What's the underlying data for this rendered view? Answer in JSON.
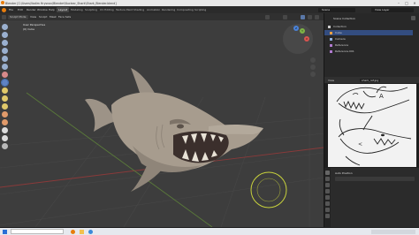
{
  "window": {
    "title": "Blender [C:\\Users\\Vadim Hrysnov\\Blender\\Nuclear_Shark\\Shark_Blender.blend]",
    "controls": [
      "–",
      "□",
      "✕"
    ]
  },
  "menu": {
    "items": [
      "File",
      "Edit",
      "Render",
      "Window",
      "Help"
    ],
    "tabs": [
      "Layout",
      "Modeling",
      "Sculpting",
      "UV Editing",
      "Texture Paint",
      "Shading",
      "Animation",
      "Rendering",
      "Compositing",
      "Scripting"
    ],
    "active_tab": "Layout",
    "scene_label": "Scene",
    "view_layer_label": "View Layer"
  },
  "viewport": {
    "mode_label": "Sculpt Mode",
    "header_menus": [
      "View",
      "Sculpt",
      "Mask",
      "Face Sets"
    ],
    "info_line1": "User Perspective",
    "info_line2": "(0) Cube",
    "gizmo_axes": [
      "X",
      "Y",
      "Z"
    ]
  },
  "outliner": {
    "header": "Scene Collection",
    "rows": [
      {
        "label": "Collection",
        "type": "collection",
        "selected": false
      },
      {
        "label": "Cube",
        "type": "mesh",
        "selected": true
      },
      {
        "label": "Camera",
        "type": "camera",
        "selected": false
      },
      {
        "label": "Reference",
        "type": "image",
        "selected": false
      },
      {
        "label": "Reference.001",
        "type": "image",
        "selected": false
      }
    ]
  },
  "image_editor": {
    "header_label": "View",
    "image_name": "shark_ref.jpg"
  },
  "properties": {
    "section": "Auto Position"
  },
  "colors": {
    "accent": "#4772b3",
    "active_selection": "#334d80",
    "shark_body": "#a79c8e",
    "brush_circle": "#c8d23c"
  }
}
